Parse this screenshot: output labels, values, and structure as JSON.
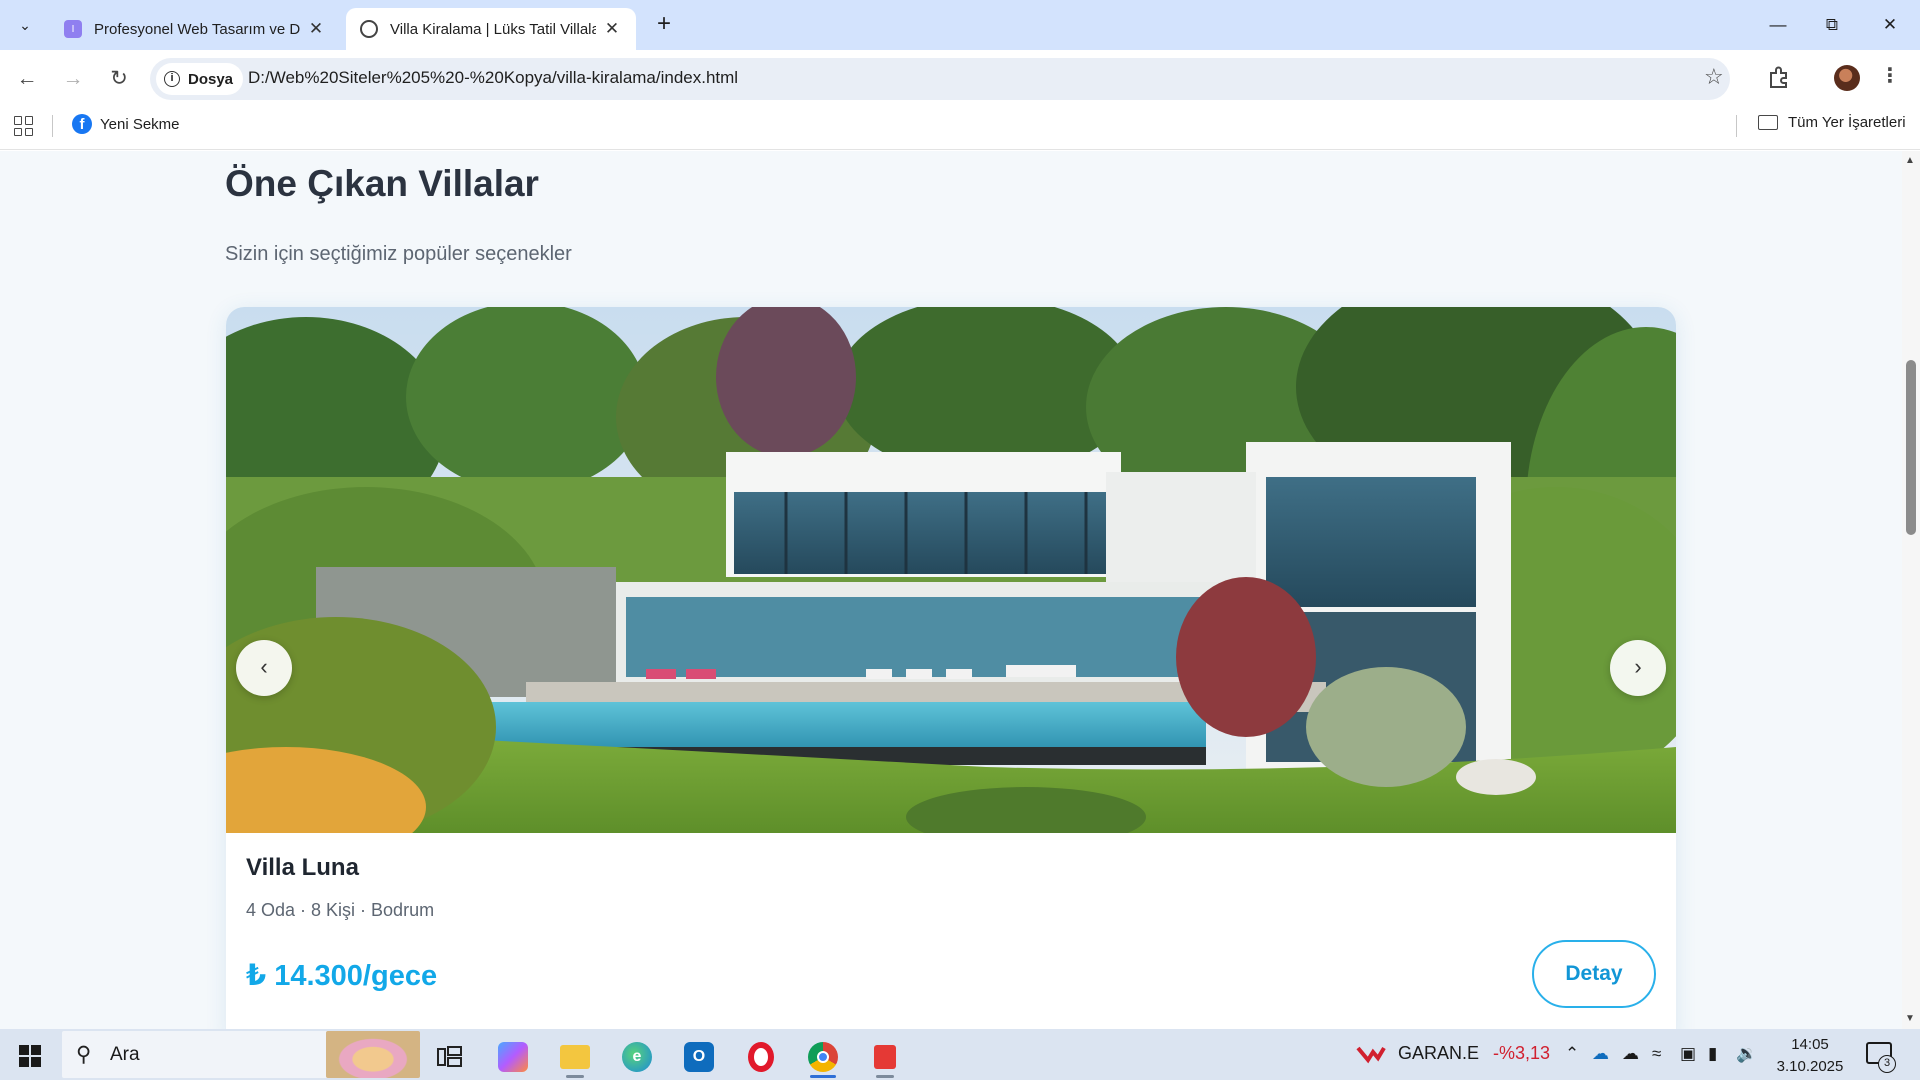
{
  "browser": {
    "tabs": [
      {
        "title": "Profesyonel Web Tasarım ve Dij",
        "active": false
      },
      {
        "title": "Villa Kiralama | Lüks Tatil Villalar",
        "active": true
      }
    ],
    "security_chip": "Dosya",
    "url": "D:/Web%20Siteler%205%20-%20Kopya/villa-kiralama/index.html",
    "bookmarks": [
      {
        "label": "Yeni Sekme",
        "icon": "facebook-icon"
      }
    ],
    "all_bookmarks_label": "Tüm Yer İşaretleri"
  },
  "page": {
    "section_title": "Öne Çıkan Villalar",
    "section_subtitle": "Sizin için seçtiğimiz popüler seçenekler",
    "card": {
      "name": "Villa Luna",
      "meta": "4 Oda · 8 Kişi · Bodrum",
      "price": "₺ 14.300/gece",
      "detail_label": "Detay",
      "prev_label": "‹",
      "next_label": "›"
    }
  },
  "taskbar": {
    "search_placeholder": "Ara",
    "ticker_symbol": "GARAN.E",
    "ticker_change": "-%3,13",
    "time": "14:05",
    "date": "3.10.2025",
    "notification_count": "3"
  },
  "colors": {
    "accent": "#12a8e8",
    "tabstrip": "#d3e3fd",
    "taskbar": "#dbe4f1",
    "ticker_negative": "#d1202f"
  }
}
